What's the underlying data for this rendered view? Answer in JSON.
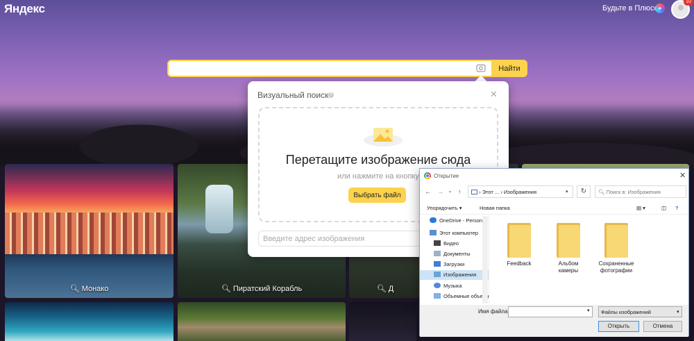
{
  "header": {
    "logo": "Яндекс",
    "plus_link": "Будьте в Плюсе",
    "plus_icon": "plus-icon",
    "avatar_badge": "10"
  },
  "search": {
    "value": "",
    "find_label": "Найти",
    "camera_icon": "camera-icon",
    "accent": "#fdd24c"
  },
  "tiles": [
    {
      "caption": "Монако"
    },
    {
      "caption": "Пиратский Корабль"
    },
    {
      "caption": "Д"
    }
  ],
  "visual_search": {
    "title": "Визуальный поиск",
    "drop_main": "Перетащите изображение сюда",
    "drop_sub": "или нажмите на кнопку",
    "choose_file": "Выбрать файл",
    "url_placeholder": "Введите адрес изображения"
  },
  "open_dialog": {
    "title": "Открытие",
    "path": {
      "part1": "Этот ...",
      "sep": "›",
      "part2": "Изображения"
    },
    "search_placeholder": "Поиск в: Изображения",
    "toolbar": {
      "organize": "Упорядочить ▾",
      "new_folder": "Новая папка"
    },
    "sidebar": [
      {
        "label": "OneDrive - Personal",
        "icon": "cloud-icon"
      },
      {
        "label": "Этот компьютер",
        "icon": "computer-icon"
      },
      {
        "label": "Видео",
        "icon": "video-icon"
      },
      {
        "label": "Документы",
        "icon": "document-icon"
      },
      {
        "label": "Загрузки",
        "icon": "download-icon"
      },
      {
        "label": "Изображения",
        "icon": "pictures-icon",
        "selected": true
      },
      {
        "label": "Музыка",
        "icon": "music-icon"
      },
      {
        "label": "Объемные объекты",
        "icon": "3d-objects-icon"
      }
    ],
    "folders": [
      {
        "label": "Feedback"
      },
      {
        "label": "Альбом камеры"
      },
      {
        "label": "Сохраненные фотографии"
      }
    ],
    "filename_label": "Имя файла:",
    "filename_value": "",
    "filetype": "Файлы изображений",
    "open_btn": "Открыть",
    "cancel_btn": "Отмена"
  }
}
